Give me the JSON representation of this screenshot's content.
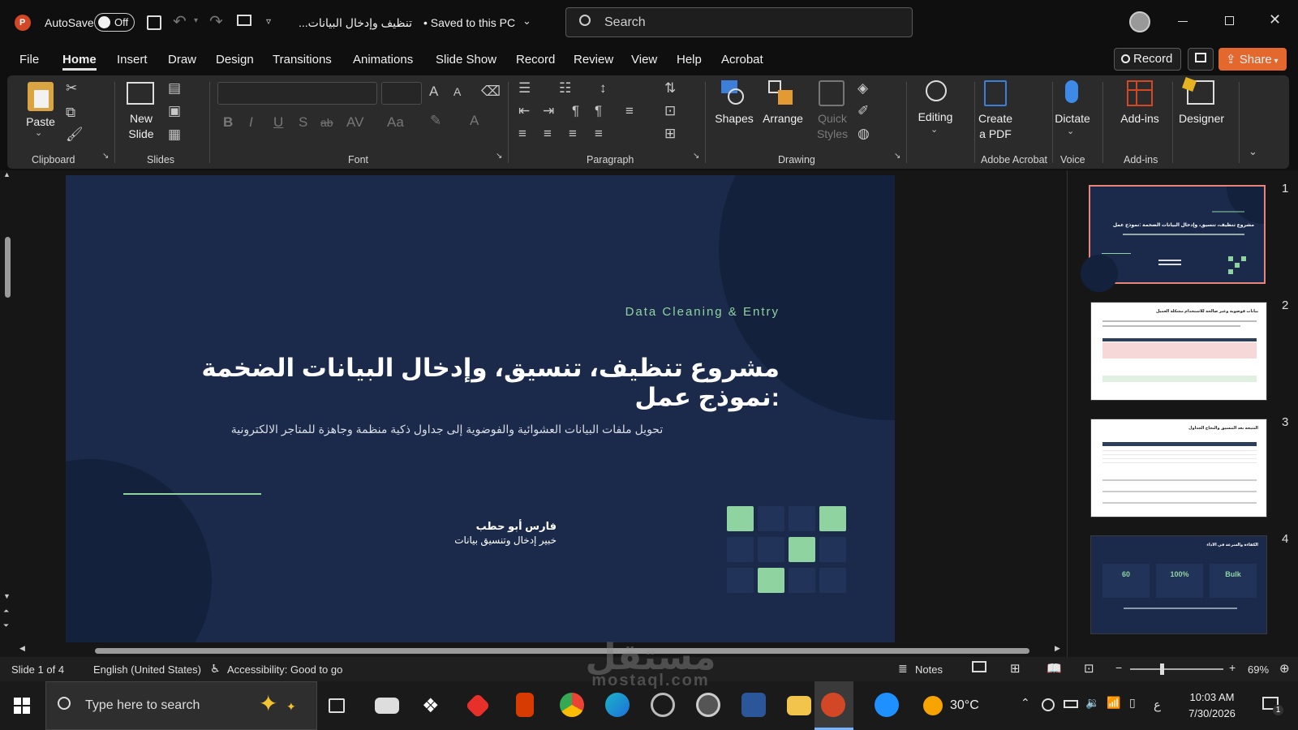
{
  "titlebar": {
    "autosave_label": "AutoSave",
    "autosave_state": "Off",
    "doc_title": "تنظيف وإدخال البيانات...",
    "save_status": "• Saved to this PC",
    "search_placeholder": "Search",
    "icons": [
      "powerpoint-logo-icon",
      "save-icon",
      "undo-icon",
      "redo-icon",
      "present-icon",
      "customize-icon",
      "search-icon",
      "account-icon",
      "minimize-icon",
      "restore-icon",
      "close-icon"
    ]
  },
  "menu": {
    "tabs": [
      "File",
      "Home",
      "Insert",
      "Draw",
      "Design",
      "Transitions",
      "Animations",
      "Slide Show",
      "Record",
      "Review",
      "View",
      "Help",
      "Acrobat"
    ],
    "active": "Home",
    "record_label": "Record",
    "share_label": "Share"
  },
  "ribbon": {
    "clipboard": {
      "paste": "Paste",
      "group": "Clipboard"
    },
    "slides": {
      "new_slide_line1": "New",
      "new_slide_line2": "Slide",
      "group": "Slides"
    },
    "font": {
      "group": "Font",
      "bold": "B",
      "italic": "I",
      "underline": "U",
      "shadow": "S",
      "strike": "ab",
      "spacing": "AV",
      "case": "Aa",
      "grow": "A",
      "shrink": "A"
    },
    "paragraph": {
      "group": "Paragraph"
    },
    "drawing": {
      "shapes": "Shapes",
      "arrange": "Arrange",
      "quick_styles_line1": "Quick",
      "quick_styles_line2": "Styles",
      "group": "Drawing"
    },
    "editing": {
      "label": "Editing"
    },
    "acrobat": {
      "create_line1": "Create",
      "create_line2": "a PDF",
      "group": "Adobe Acrobat"
    },
    "voice": {
      "dictate": "Dictate",
      "group": "Voice"
    },
    "addins": {
      "label": "Add-ins",
      "group": "Add-ins"
    },
    "designer": {
      "label": "Designer"
    }
  },
  "slide": {
    "eyebrow": "Data Cleaning & Entry",
    "title": "مشروع تنظيف، تنسيق، وإدخال البيانات الضخمة :نموذج عمل",
    "subtitle": "تحويل ملفات البيانات العشوائية والفوضوية إلى جداول ذكية منظمة وجاهزة للمتاجر الالكترونية",
    "author_name": "فارس أبو حطب",
    "author_role": "خبير إدخال وتنسيق بيانات",
    "colors": {
      "background": "#1b2a4a",
      "circle": "#13213d",
      "accent": "#8fd3a0"
    },
    "grid_pattern": [
      [
        1,
        0,
        0,
        1
      ],
      [
        0,
        0,
        1,
        0
      ],
      [
        0,
        1,
        0,
        0
      ]
    ]
  },
  "thumbnails": [
    {
      "number": "1",
      "selected": true,
      "mini_title": "مشروع تنظيف، تنسيق، وإدخال البيانات الضخمة :نموذج عمل"
    },
    {
      "number": "2",
      "selected": false,
      "mini_title": "بيانات فوضوية وغير صالحة للاستخدام مشكلة العميل"
    },
    {
      "number": "3",
      "selected": false,
      "mini_title": "النتيجة بعد التنسيق والنجاح الجداول"
    },
    {
      "number": "4",
      "selected": false,
      "mini_title": "الكفاءة والسرعة في الأداء",
      "stats": [
        "60",
        "100%",
        "Bulk"
      ]
    }
  ],
  "statusbar": {
    "slide_info": "Slide 1 of 4",
    "language": "English (United States)",
    "accessibility": "Accessibility: Good to go",
    "notes": "Notes",
    "zoom": "69%"
  },
  "taskbar": {
    "search_placeholder": "Type here to search",
    "weather": "30°C",
    "time": "10:03 AM",
    "date": "7/30/2026",
    "input_lang": "ع",
    "notif_count": "1",
    "apps": [
      "task-view-icon",
      "mail-icon",
      "dropbox-icon",
      "app-red-icon",
      "office-icon",
      "chrome-icon",
      "edge-icon",
      "settings-icon",
      "app-dark-icon",
      "word-icon",
      "file-explorer-icon",
      "powerpoint-icon",
      "help-icon"
    ]
  },
  "watermark": {
    "text_ar": "مستقل",
    "text_en": "mostaql.com"
  }
}
